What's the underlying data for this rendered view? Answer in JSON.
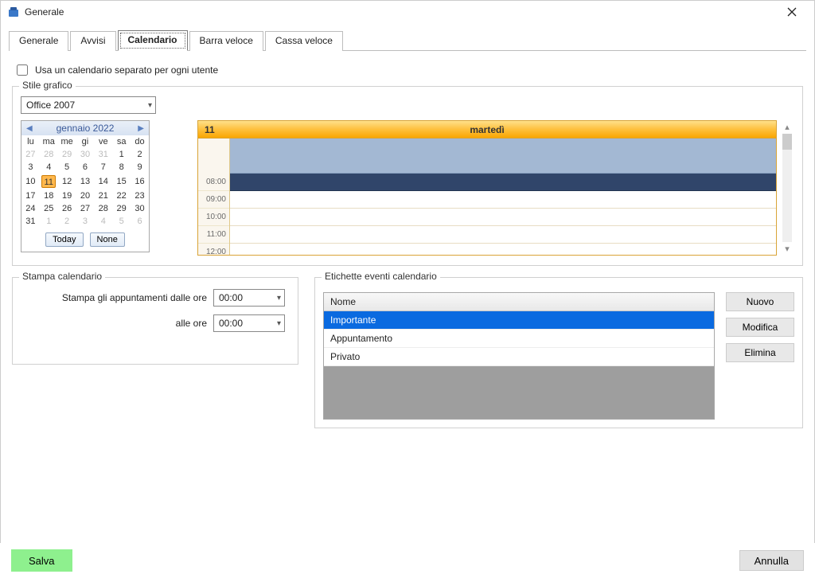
{
  "window": {
    "title": "Generale"
  },
  "tabs": [
    "Generale",
    "Avvisi",
    "Calendario",
    "Barra veloce",
    "Cassa veloce"
  ],
  "active_tab_index": 2,
  "separate_calendar": {
    "label": "Usa un calendario separato per ogni utente",
    "checked": false
  },
  "style_group": {
    "legend": "Stile grafico",
    "combo_value": "Office 2007"
  },
  "minical": {
    "title": "gennaio 2022",
    "dow": [
      "lu",
      "ma",
      "me",
      "gi",
      "ve",
      "sa",
      "do"
    ],
    "weeks": [
      [
        {
          "n": 27,
          "dim": true
        },
        {
          "n": 28,
          "dim": true
        },
        {
          "n": 29,
          "dim": true
        },
        {
          "n": 30,
          "dim": true
        },
        {
          "n": 31,
          "dim": true
        },
        {
          "n": 1
        },
        {
          "n": 2
        }
      ],
      [
        {
          "n": 3
        },
        {
          "n": 4
        },
        {
          "n": 5
        },
        {
          "n": 6
        },
        {
          "n": 7
        },
        {
          "n": 8
        },
        {
          "n": 9
        }
      ],
      [
        {
          "n": 10
        },
        {
          "n": 11,
          "sel": true
        },
        {
          "n": 12
        },
        {
          "n": 13
        },
        {
          "n": 14
        },
        {
          "n": 15
        },
        {
          "n": 16
        }
      ],
      [
        {
          "n": 17
        },
        {
          "n": 18
        },
        {
          "n": 19
        },
        {
          "n": 20
        },
        {
          "n": 21
        },
        {
          "n": 22
        },
        {
          "n": 23
        }
      ],
      [
        {
          "n": 24
        },
        {
          "n": 25
        },
        {
          "n": 26
        },
        {
          "n": 27
        },
        {
          "n": 28
        },
        {
          "n": 29
        },
        {
          "n": 30
        }
      ],
      [
        {
          "n": 31
        },
        {
          "n": 1,
          "dim": true
        },
        {
          "n": 2,
          "dim": true
        },
        {
          "n": 3,
          "dim": true
        },
        {
          "n": 4,
          "dim": true
        },
        {
          "n": 5,
          "dim": true
        },
        {
          "n": 6,
          "dim": true
        }
      ]
    ],
    "today_btn": "Today",
    "none_btn": "None"
  },
  "dayview": {
    "day_number": "11",
    "day_name": "martedì",
    "times": [
      "08:00",
      "09:00",
      "10:00",
      "11:00",
      "12:00"
    ]
  },
  "print_group": {
    "legend": "Stampa calendario",
    "from_label": "Stampa gli appuntamenti dalle ore",
    "from_value": "00:00",
    "to_label": "alle ore",
    "to_value": "00:00"
  },
  "labels_group": {
    "legend": "Etichette eventi calendario",
    "header": "Nome",
    "items": [
      "Importante",
      "Appuntamento",
      "Privato"
    ],
    "selected_index": 0,
    "new_btn": "Nuovo",
    "edit_btn": "Modifica",
    "del_btn": "Elimina"
  },
  "footer": {
    "save": "Salva",
    "cancel": "Annulla"
  }
}
